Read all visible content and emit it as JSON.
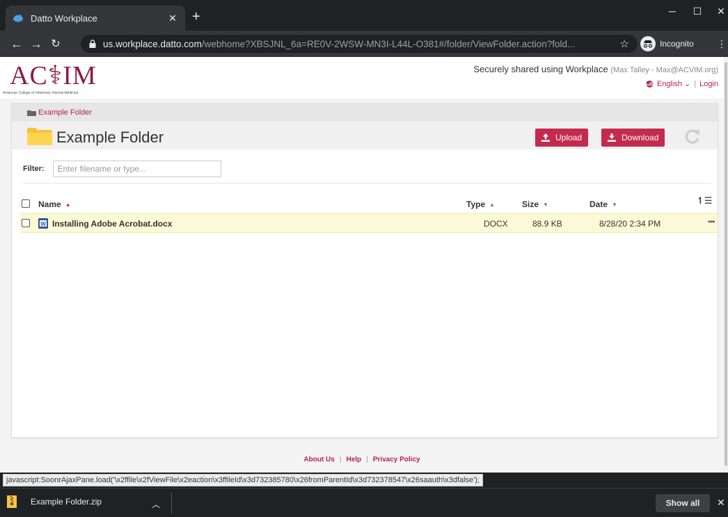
{
  "browser": {
    "tab_title": "Datto Workplace",
    "url_host": "us.workplace.datto.com",
    "url_path": "/webhome?XBSJNL_6a=RE0V-2WSW-MN3I-L44L-O381#/folder/ViewFolder.action?fold...",
    "incognito_label": "Incognito"
  },
  "header": {
    "logo_text": "AC⚕IM",
    "logo_subtitle": "American College of Veterinary Internal Medicine",
    "secure_text": "Securely shared using Workplace",
    "secure_user": "(Max Talley - Max@ACVIM.org)",
    "language": "English ⌄",
    "login": "Login"
  },
  "folder": {
    "breadcrumb": "Example Folder",
    "title": "Example Folder",
    "upload_label": "Upload",
    "download_label": "Download",
    "filter_label": "Filter:",
    "filter_placeholder": "Enter filename or type..."
  },
  "table": {
    "columns": {
      "name": "Name",
      "type": "Type",
      "size": "Size",
      "date": "Date"
    },
    "rows": [
      {
        "name": "Installing Adobe Acrobat.docx",
        "type": "DOCX",
        "size": "88.9 KB",
        "date": "8/28/20 2:34 PM"
      }
    ]
  },
  "footer": {
    "about": "About Us",
    "help": "Help",
    "privacy": "Privacy Policy"
  },
  "status_text": "javascript:SoonrAjaxPane.load('\\x2ffile\\x2fViewFile\\x2eaction\\x3ffileId\\x3d732385780\\x26fromParentId\\x3d732378547\\x26saauth\\x3dfalse');",
  "download_shelf": {
    "file_name": "Example Folder.zip",
    "show_all": "Show all"
  },
  "colors": {
    "brand": "#8c1d40",
    "accent_button": "#c42a4e",
    "row_highlight": "#fdf9d6"
  }
}
